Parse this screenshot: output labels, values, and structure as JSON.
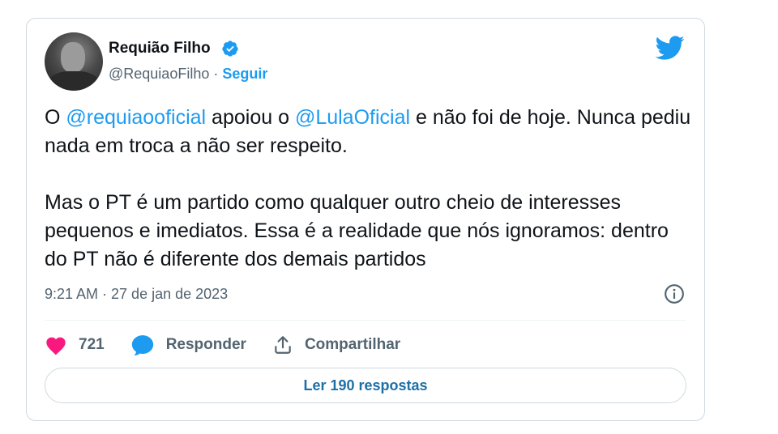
{
  "author": {
    "name": "Requião Filho",
    "handle": "@RequiaoFilho",
    "separator": " · ",
    "follow_label": "Seguir"
  },
  "tweet": {
    "p1": {
      "mention1": "@requiaooficial",
      "t1": " apoiou o ",
      "mention2": "@LulaOficial",
      "t2": " e não foi de hoje. Nunca pediu nada em troca a não ser respeito.",
      "prefix": "O "
    },
    "p2": "Mas o PT é um partido como qualquer outro cheio de interesses pequenos e imediatos. Essa é a realidade que nós ignoramos: dentro do PT não é diferente dos demais partidos",
    "timestamp": "9:21 AM · 27 de jan de 2023"
  },
  "actions": {
    "like_count": "721",
    "reply_label": "Responder",
    "share_label": "Compartilhar"
  },
  "replies_button": "Ler 190 respostas",
  "colors": {
    "accent": "#1d9bf0",
    "like": "#f91880",
    "text": "#0f1419",
    "muted": "#536471"
  }
}
